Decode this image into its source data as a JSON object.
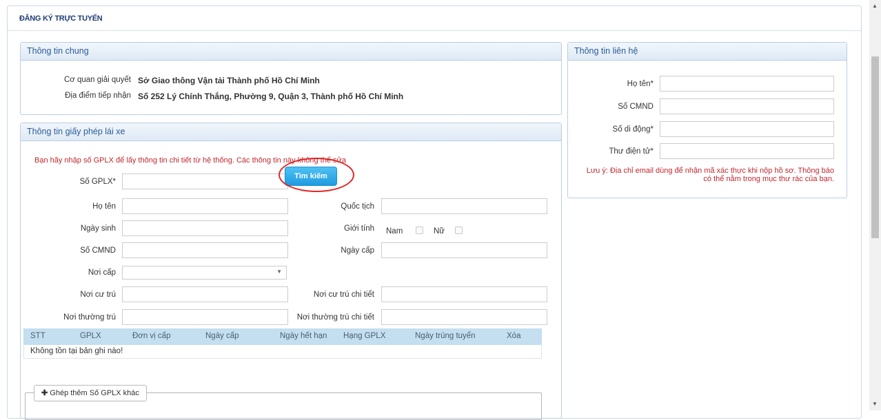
{
  "page": {
    "title": "ĐĂNG KÝ TRỰC TUYẾN"
  },
  "general": {
    "header": "Thông tin chung",
    "agency_label": "Cơ quan giải quyết",
    "agency_value": "Sở Giao thông Vận tải Thành phố Hồ Chí Minh",
    "location_label": "Địa điểm tiếp nhận",
    "location_value": "Số 252 Lý Chính Thắng, Phường 9, Quận 3, Thành phố Hồ Chí Minh"
  },
  "license": {
    "header": "Thông tin giấy phép lái xe",
    "note": "Bạn hãy nhập số GPLX để lấy thông tin chi tiết từ hệ thống. Các thông tin này không thể sửa",
    "gplx_label": "Số GPLX*",
    "search_button": "Tìm kiếm",
    "name_label": "Họ tên",
    "nationality_label": "Quốc tịch",
    "dob_label": "Ngày sinh",
    "gender_label": "Giới tính",
    "gender_male": "Nam",
    "gender_female": "Nữ",
    "id_label": "Số CMND",
    "issue_date_label": "Ngày cấp",
    "issue_place_label": "Nơi cấp",
    "residence_label": "Nơi cư trú",
    "residence_detail_label": "Nơi cư trú chi tiết",
    "permanent_label": "Nơi thường trú",
    "permanent_detail_label": "Nơi thường trú chi tiết"
  },
  "table": {
    "columns": [
      "STT",
      "GPLX",
      "Đơn vị cấp",
      "Ngày cấp",
      "Ngày hết hạn",
      "Hạng GPLX",
      "Ngày trúng tuyển",
      "Xóa"
    ],
    "empty_message": "Không tồn tại bản ghi nào!"
  },
  "add_more": {
    "icon": "plus-icon",
    "label": "Ghép thêm Số GPLX khác"
  },
  "contact": {
    "header": "Thông tin liên hệ",
    "name_label": "Họ tên*",
    "id_label": "Số CMND",
    "phone_label": "Số di động*",
    "email_label": "Thư điện tử*",
    "note": "Lưu ý: Địa chỉ email dùng để nhận mã xác thực khi nộp hồ sơ. Thông báo có thể nằm trong mục thư rác của bạn."
  },
  "colors": {
    "title": "#1f3e73",
    "panel_header": "#2b5d98",
    "note": "#c0272d",
    "button": "#1f9be0",
    "highlight_ring": "#e02525"
  }
}
